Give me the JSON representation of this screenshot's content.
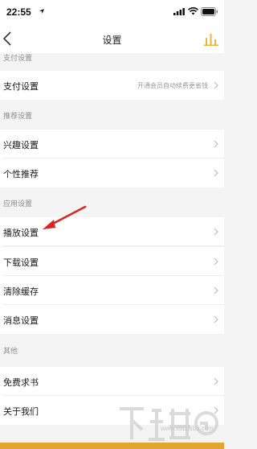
{
  "status_bar": {
    "time": "22:55"
  },
  "nav": {
    "title": "设置",
    "back_icon": "chevron-left-icon",
    "right_icon": "stats-bars-icon",
    "accent_color": "#f0b23a"
  },
  "sections": {
    "payment": {
      "header": "支付设置",
      "items": [
        {
          "label": "支付设置",
          "value": "开通会员自动续费更省钱"
        }
      ]
    },
    "recommend": {
      "header": "推荐设置",
      "items": [
        {
          "label": "兴趣设置"
        },
        {
          "label": "个性推荐"
        }
      ]
    },
    "app": {
      "header": "应用设置",
      "items": [
        {
          "label": "播放设置"
        },
        {
          "label": "下载设置"
        },
        {
          "label": "清除缓存"
        },
        {
          "label": "消息设置"
        }
      ]
    },
    "other": {
      "header": "其他",
      "items": [
        {
          "label": "免费求书"
        },
        {
          "label": "关于我们"
        }
      ]
    }
  },
  "annotation": {
    "arrow_color": "#e02222"
  },
  "watermark": {
    "url": "www.xiazaiba.com"
  }
}
